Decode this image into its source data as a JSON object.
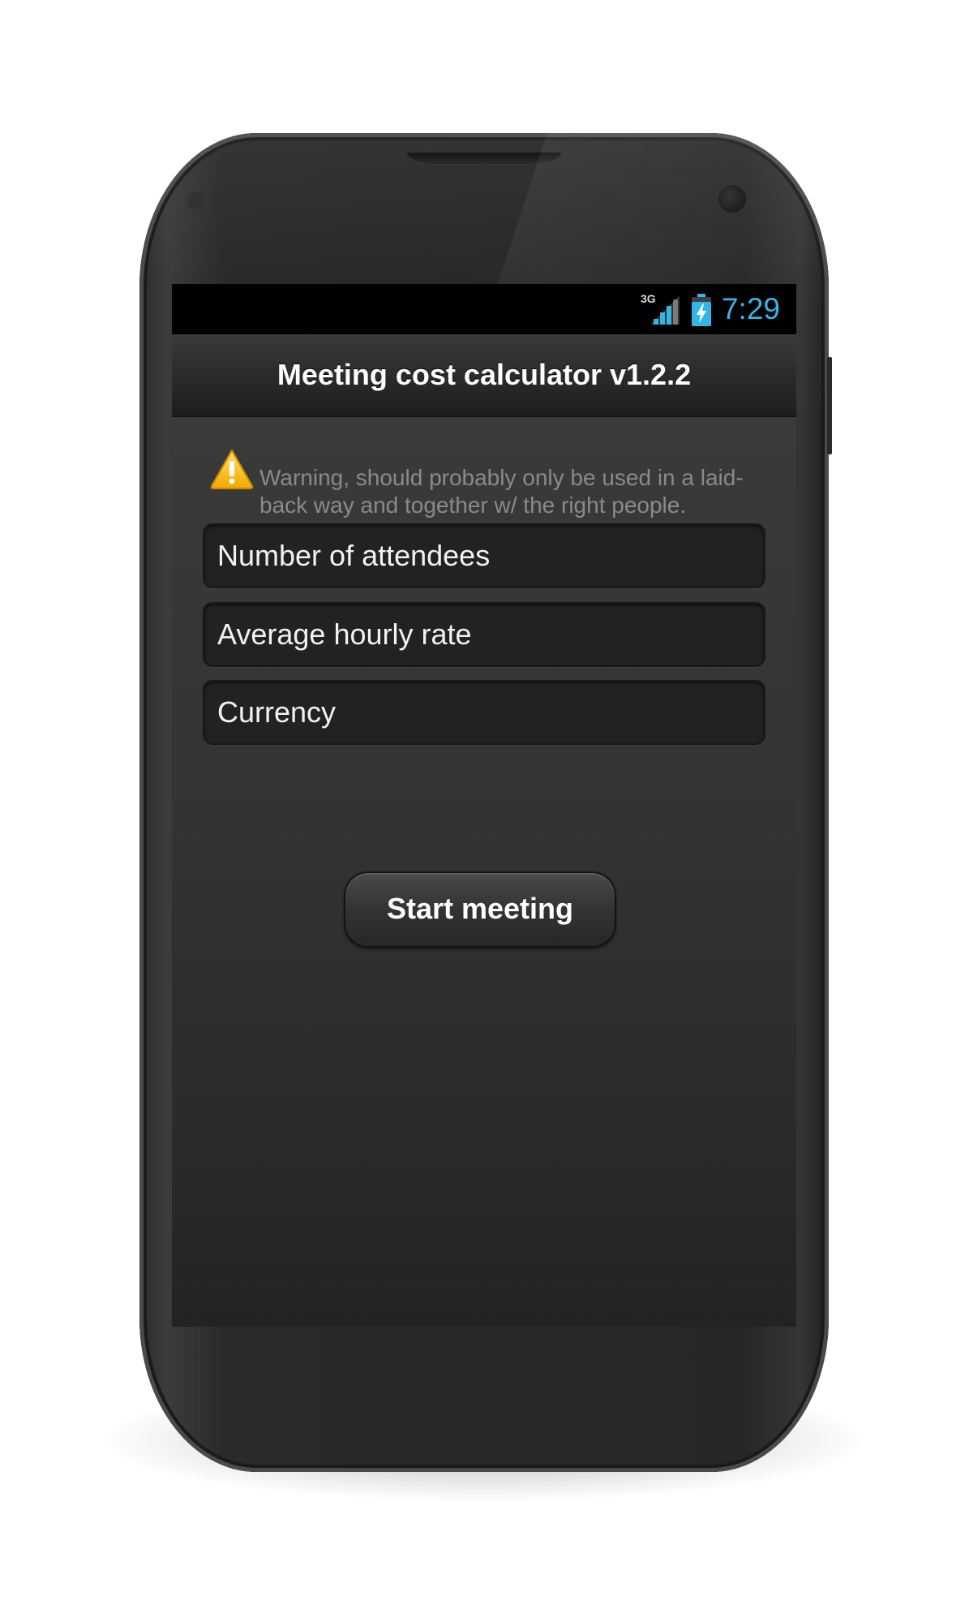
{
  "status_bar": {
    "network_type": "3G",
    "signal_icon": "signal-strength-icon",
    "battery_icon": "battery-charging-icon",
    "time": "7:29",
    "time_color": "#33b5e5"
  },
  "action_bar": {
    "title": "Meeting cost calculator v1.2.2"
  },
  "warning": {
    "icon": "warning-icon",
    "text": "Warning, should probably only be used in a laid-back way and together w/ the right people."
  },
  "form": {
    "attendees_placeholder": "Number of attendees",
    "hourly_rate_placeholder": "Average hourly rate",
    "currency_placeholder": "Currency",
    "start_button_label": "Start meeting"
  }
}
